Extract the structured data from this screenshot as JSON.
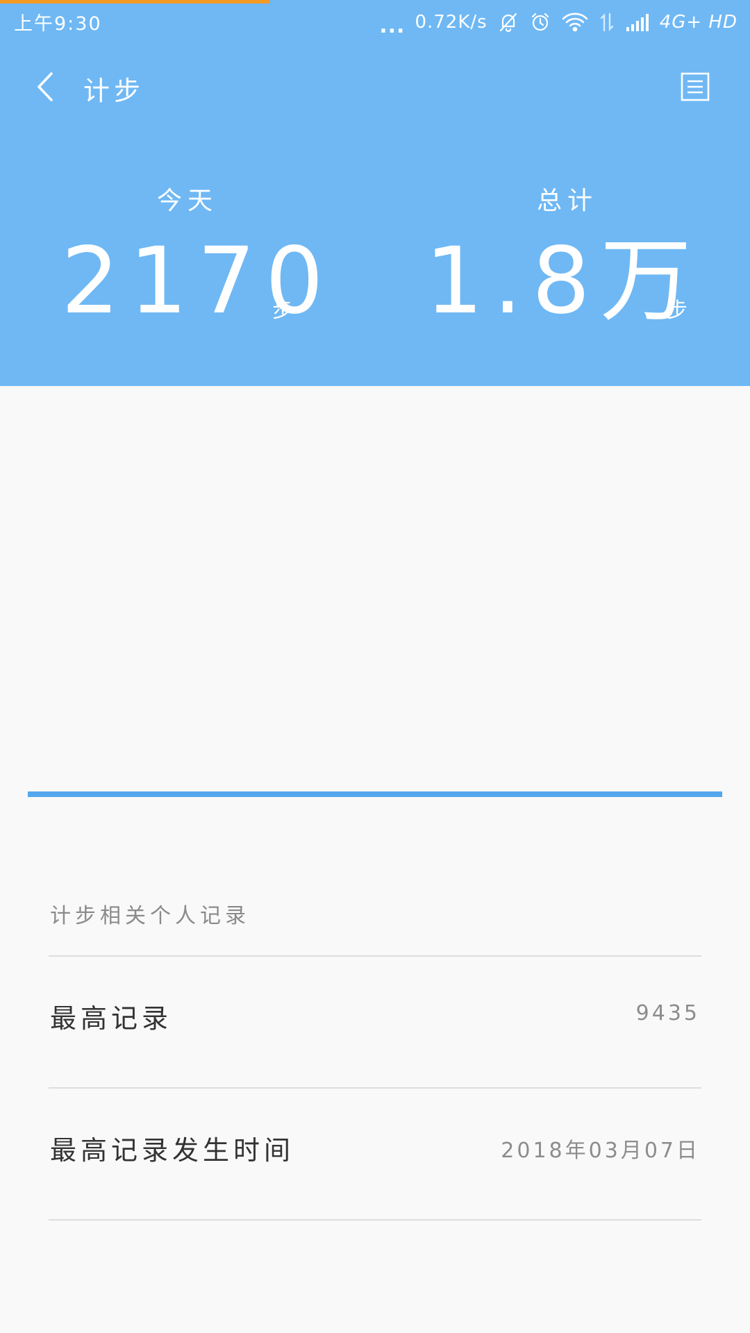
{
  "status_bar": {
    "time": "上午9:30",
    "more": "...",
    "network_speed": "0.72K/s",
    "network_type": "4G+ HD",
    "icons": [
      "bell-off-icon",
      "alarm-icon",
      "wifi-icon",
      "data-arrows-icon",
      "signal-icon"
    ]
  },
  "toolbar": {
    "title": "计步",
    "back_icon": "chevron-left-icon",
    "menu_icon": "list-icon"
  },
  "stats": {
    "today": {
      "label": "今天",
      "value": "2170",
      "unit": "步"
    },
    "total": {
      "label": "总计",
      "value": "1.8万",
      "unit": "步"
    }
  },
  "records": {
    "section_title": "计步相关个人记录",
    "rows": [
      {
        "label": "最高记录",
        "value": "9435"
      },
      {
        "label": "最高记录发生时间",
        "value": "2018年03月07日"
      }
    ]
  },
  "colors": {
    "header_bg": "#6fb8f4",
    "accent_line": "#55a7ec",
    "load_bar": "#f59a23",
    "page_bg": "#f9f9f9"
  }
}
